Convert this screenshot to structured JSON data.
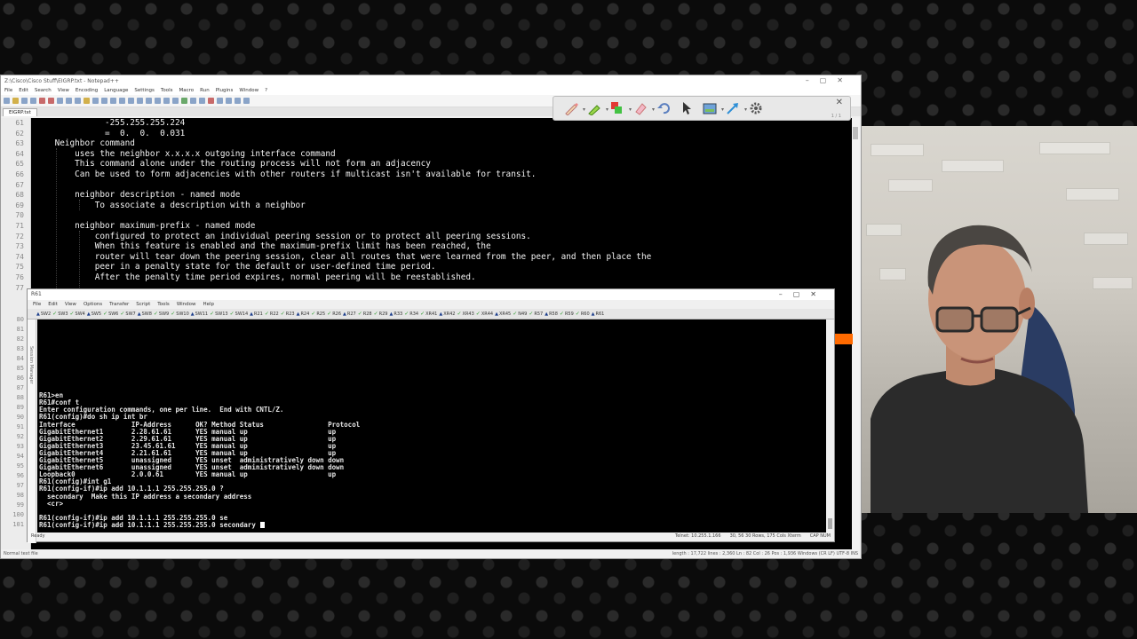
{
  "notepad": {
    "title": "Z:\\Cisco\\Cisco Stuff\\EIGRP.txt - Notepad++",
    "menu": [
      "File",
      "Edit",
      "Search",
      "View",
      "Encoding",
      "Language",
      "Settings",
      "Tools",
      "Macro",
      "Run",
      "Plugins",
      "Window",
      "?"
    ],
    "tab": "EIGRP.txt",
    "line_numbers": [
      "61",
      "62",
      "63",
      "64",
      "65",
      "66",
      "67",
      "68",
      "69",
      "70",
      "71",
      "72",
      "73",
      "74",
      "75",
      "76",
      "77"
    ],
    "code_lines": [
      "              -255.255.255.224",
      "              =  0.  0.  0.031",
      "    Neighbor command",
      "        uses the neighbor x.x.x.x outgoing interface command",
      "        This command alone under the routing process will not form an adjacency",
      "        Can be used to form adjacencies with other routers if multicast isn't available for transit.",
      "",
      "        neighbor description - named mode",
      "            To associate a description with a neighbor",
      "",
      "        neighbor maximum-prefix - named mode",
      "            configured to protect an individual peering session or to protect all peering sessions.",
      "            When this feature is enabled and the maximum-prefix limit has been reached, the",
      "            router will tear down the peering session, clear all routes that were learned from the peer, and then place the",
      "            peer in a penalty state for the default or user-defined time period.",
      "            After the penalty time period expires, normal peering will be reestablished.",
      ""
    ],
    "hidden_line_numbers": [
      "80",
      "81",
      "82",
      "83",
      "84",
      "85",
      "86",
      "87",
      "88",
      "89",
      "90",
      "91",
      "92",
      "93",
      "94",
      "95",
      "96",
      "97",
      "98",
      "99",
      "100",
      "101"
    ],
    "status_left": "Normal text file",
    "status_right": "length : 17,722    lines : 2,360        Ln : 82    Col : 26    Pos : 1,936        Windows (CR LF)    UTF-8        INS"
  },
  "annotation_toolbar": {
    "tools": [
      "pen-icon",
      "highlighter-icon",
      "color-icon",
      "eraser-icon",
      "undo-icon",
      "pointer-icon",
      "screenshot-icon",
      "arrow-icon",
      "settings-icon"
    ],
    "page": "1 / 1",
    "close": "✕"
  },
  "securecrt": {
    "title": "R61",
    "menu": [
      "File",
      "Edit",
      "View",
      "Options",
      "Transfer",
      "Script",
      "Tools",
      "Window",
      "Help"
    ],
    "session_tabs": [
      "SW2",
      "SW3",
      "SW4",
      "SW5",
      "SW6",
      "SW7",
      "SW8",
      "SW9",
      "SW10",
      "SW11",
      "SW13",
      "SW14",
      "R21",
      "R22",
      "R23",
      "R24",
      "R25",
      "R26",
      "R27",
      "R28",
      "R29",
      "R33",
      "R34",
      "XR41",
      "XR42",
      "XR43",
      "XR44",
      "XR45",
      "N49",
      "R57",
      "R58",
      "R59",
      "R60",
      "R61"
    ],
    "side_label": "Session Manager",
    "terminal_lines": [
      "R61>en",
      "R61#conf t",
      "Enter configuration commands, one per line.  End with CNTL/Z.",
      "R61(config)#do sh ip int br",
      "Interface              IP-Address      OK? Method Status                Protocol",
      "GigabitEthernet1       2.28.61.61      YES manual up                    up",
      "GigabitEthernet2       2.29.61.61      YES manual up                    up",
      "GigabitEthernet3       23.45.61.61     YES manual up                    up",
      "GigabitEthernet4       2.21.61.61      YES manual up                    up",
      "GigabitEthernet5       unassigned      YES unset  administratively down down",
      "GigabitEthernet6       unassigned      YES unset  administratively down down",
      "Loopback0              2.0.0.61        YES manual up                    up",
      "R61(config)#int g1",
      "R61(config-if)#ip add 10.1.1.1 255.255.255.0 ?",
      "  secondary  Make this IP address a secondary address",
      "  <cr>",
      "",
      "R61(config-if)#ip add 10.1.1.1 255.255.255.0 se",
      "R61(config-if)#ip add 10.1.1.1 255.255.255.0 secondary "
    ],
    "status_left": "Ready",
    "status_items": [
      "Telnet: 10.255.1.166",
      "30,  56  30 Rows, 175 Cols  Xterm",
      "CAP  NUM"
    ]
  },
  "colors": {
    "editor_bg": "#000000",
    "editor_text": "#f2f2f2",
    "terminal_bg": "#000000",
    "accent_orange": "#ff6a00"
  }
}
